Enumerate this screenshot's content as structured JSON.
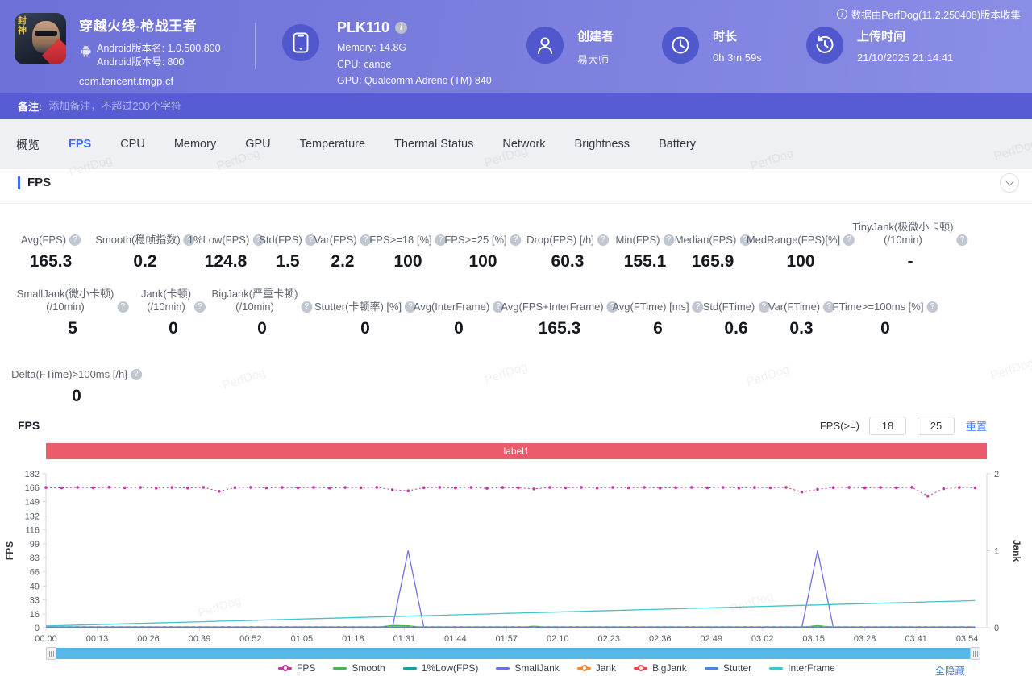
{
  "header": {
    "game": {
      "title": "穿越火线-枪战王者",
      "icon_text": "封神",
      "android_version_name": "Android版本名: 1.0.500.800",
      "android_version_code": "Android版本号: 800",
      "package": "com.tencent.tmgp.cf"
    },
    "device": {
      "name": "PLK110",
      "memory": "Memory: 14.8G",
      "cpu": "CPU: canoe",
      "gpu": "GPU: Qualcomm Adreno (TM) 840"
    },
    "creator": {
      "label": "创建者",
      "value": "易大师"
    },
    "duration": {
      "label": "时长",
      "value": "0h 3m 59s"
    },
    "upload": {
      "label": "上传时间",
      "value": "21/10/2025 21:14:41"
    },
    "collect_note": "数据由PerfDog(11.2.250408)版本收集"
  },
  "remark": {
    "label": "备注:",
    "placeholder": "添加备注，不超过200个字符"
  },
  "tabs": [
    "概览",
    "FPS",
    "CPU",
    "Memory",
    "GPU",
    "Temperature",
    "Thermal Status",
    "Network",
    "Brightness",
    "Battery"
  ],
  "active_tab": "FPS",
  "section": {
    "title": "FPS"
  },
  "stats": {
    "row1": [
      {
        "label": "Avg(FPS)",
        "value": "165.3",
        "help": false
      },
      {
        "label": "Smooth(稳帧指数)",
        "value": "0.2",
        "help": true
      },
      {
        "label": "1%Low(FPS)",
        "value": "124.8",
        "help": false
      },
      {
        "label": "Std(FPS)",
        "value": "1.5",
        "help": false
      },
      {
        "label": "Var(FPS)",
        "value": "2.2",
        "help": false
      },
      {
        "label": "FPS>=18 [%]",
        "value": "100",
        "help": false
      },
      {
        "label": "FPS>=25 [%]",
        "value": "100",
        "help": false
      },
      {
        "label": "Drop(FPS) [/h]",
        "value": "60.3",
        "help": true
      },
      {
        "label": "Min(FPS)",
        "value": "155.1",
        "help": false
      },
      {
        "label": "Median(FPS)",
        "value": "165.9",
        "help": false
      },
      {
        "label": "MedRange(FPS)[%]",
        "value": "100",
        "help": false
      },
      {
        "label": "TinyJank(极微小卡顿)\n(/10min)",
        "value": "-",
        "help": true
      }
    ],
    "row2": [
      {
        "label": "SmallJank(微小卡顿)\n(/10min)",
        "value": "5",
        "help": true
      },
      {
        "label": "Jank(卡顿)\n(/10min)",
        "value": "0",
        "help": true
      },
      {
        "label": "BigJank(严重卡顿)\n(/10min)",
        "value": "0",
        "help": true
      },
      {
        "label": "Stutter(卡顿率) [%]",
        "value": "0",
        "help": false
      },
      {
        "label": "Avg(InterFrame)",
        "value": "0",
        "help": false
      },
      {
        "label": "Avg(FPS+InterFrame)",
        "value": "165.3",
        "help": false
      },
      {
        "label": "Avg(FTime) [ms]",
        "value": "6",
        "help": false
      },
      {
        "label": "Std(FTime)",
        "value": "0.6",
        "help": false
      },
      {
        "label": "Var(FTime)",
        "value": "0.3",
        "help": false
      },
      {
        "label": "FTime>=100ms [%]",
        "value": "0",
        "help": false
      }
    ],
    "row3": [
      {
        "label": "Delta(FTime)>100ms [/h]",
        "value": "0",
        "help": true
      }
    ]
  },
  "chart_controls": {
    "fps_ge_label": "FPS(>=)",
    "input1": "18",
    "input2": "25",
    "reset": "重置"
  },
  "label_bar": "label1",
  "hide_all": "全隐藏",
  "watermark": "PerfDog",
  "chart_data": {
    "type": "line",
    "title": "FPS",
    "duration_s": 239,
    "sample_step_s": 4,
    "x_tick_interval_s": 13,
    "x_tick_labels": [
      "00:00",
      "00:13",
      "00:26",
      "00:39",
      "00:52",
      "01:05",
      "01:18",
      "01:31",
      "01:44",
      "01:57",
      "02:10",
      "02:23",
      "02:36",
      "02:49",
      "03:02",
      "03:15",
      "03:28",
      "03:41",
      "03:54"
    ],
    "left_axis": {
      "label": "FPS",
      "ticks": [
        0,
        16,
        33,
        49,
        66,
        83,
        99,
        116,
        132,
        149,
        166,
        182
      ],
      "max": 182
    },
    "right_axis": {
      "label": "Jank",
      "ticks": [
        0,
        1,
        2
      ],
      "max": 2
    },
    "legend_position": "bottom",
    "grid": false,
    "series": [
      {
        "name": "FPS",
        "color": "#c0399f",
        "style": "dotted-marker",
        "axis": "left",
        "legend_dot": true,
        "values": [
          165.7,
          165.2,
          165.9,
          165.3,
          166.0,
          165.4,
          165.8,
          164.9,
          165.7,
          165.1,
          165.9,
          161.2,
          165.6,
          165.9,
          165.2,
          165.8,
          165.3,
          165.9,
          165.1,
          165.7,
          165.4,
          165.9,
          163.0,
          161.8,
          165.5,
          165.9,
          165.2,
          165.8,
          164.8,
          165.7,
          165.3,
          164.0,
          165.8,
          165.4,
          165.9,
          165.1,
          165.7,
          165.3,
          165.9,
          165.0,
          165.6,
          165.9,
          165.3,
          165.8,
          165.1,
          165.7,
          165.4,
          165.9,
          160.4,
          163.5,
          165.6,
          165.9,
          165.2,
          165.8,
          165.4,
          165.9,
          155.6,
          164.3,
          165.7,
          165.4
        ]
      },
      {
        "name": "Smooth",
        "color": "#4db05a",
        "style": "solid",
        "axis": "left",
        "legend_dot": false,
        "gen": {
          "type": "flat",
          "value": 0.5,
          "bumps": [
            {
              "t": 88,
              "v": 2.6
            },
            {
              "t": 92,
              "v": 2.2
            },
            {
              "t": 124,
              "v": 1.8
            },
            {
              "t": 196,
              "v": 2.5
            }
          ]
        }
      },
      {
        "name": "1%Low(FPS)",
        "color": "#1a9e98",
        "style": "solid",
        "axis": "left",
        "legend_dot": false,
        "gen": {
          "type": "flat",
          "value": 0.9
        }
      },
      {
        "name": "SmallJank",
        "color": "#6f71e3",
        "style": "solid",
        "axis": "right",
        "legend_dot": false,
        "gen": {
          "type": "flat",
          "value": 0,
          "bumps": [
            {
              "t": 92,
              "v": 1
            },
            {
              "t": 196,
              "v": 1
            }
          ]
        }
      },
      {
        "name": "Jank",
        "color": "#f0883c",
        "style": "dashed",
        "axis": "left",
        "legend_dot": true,
        "gen": {
          "type": "flat",
          "value": 1.2
        }
      },
      {
        "name": "BigJank",
        "color": "#e24b4b",
        "style": "solid",
        "axis": "left",
        "legend_dot": true,
        "gen": {
          "type": "flat",
          "value": 0
        }
      },
      {
        "name": "Stutter",
        "color": "#4f86d6",
        "style": "solid",
        "axis": "left",
        "legend_dot": false,
        "gen": {
          "type": "flat",
          "value": 0
        }
      },
      {
        "name": "InterFrame",
        "color": "#3fc3cc",
        "style": "solid",
        "axis": "left",
        "legend_dot": false,
        "gen": {
          "type": "linear",
          "from": 2,
          "to": 32
        }
      }
    ]
  }
}
